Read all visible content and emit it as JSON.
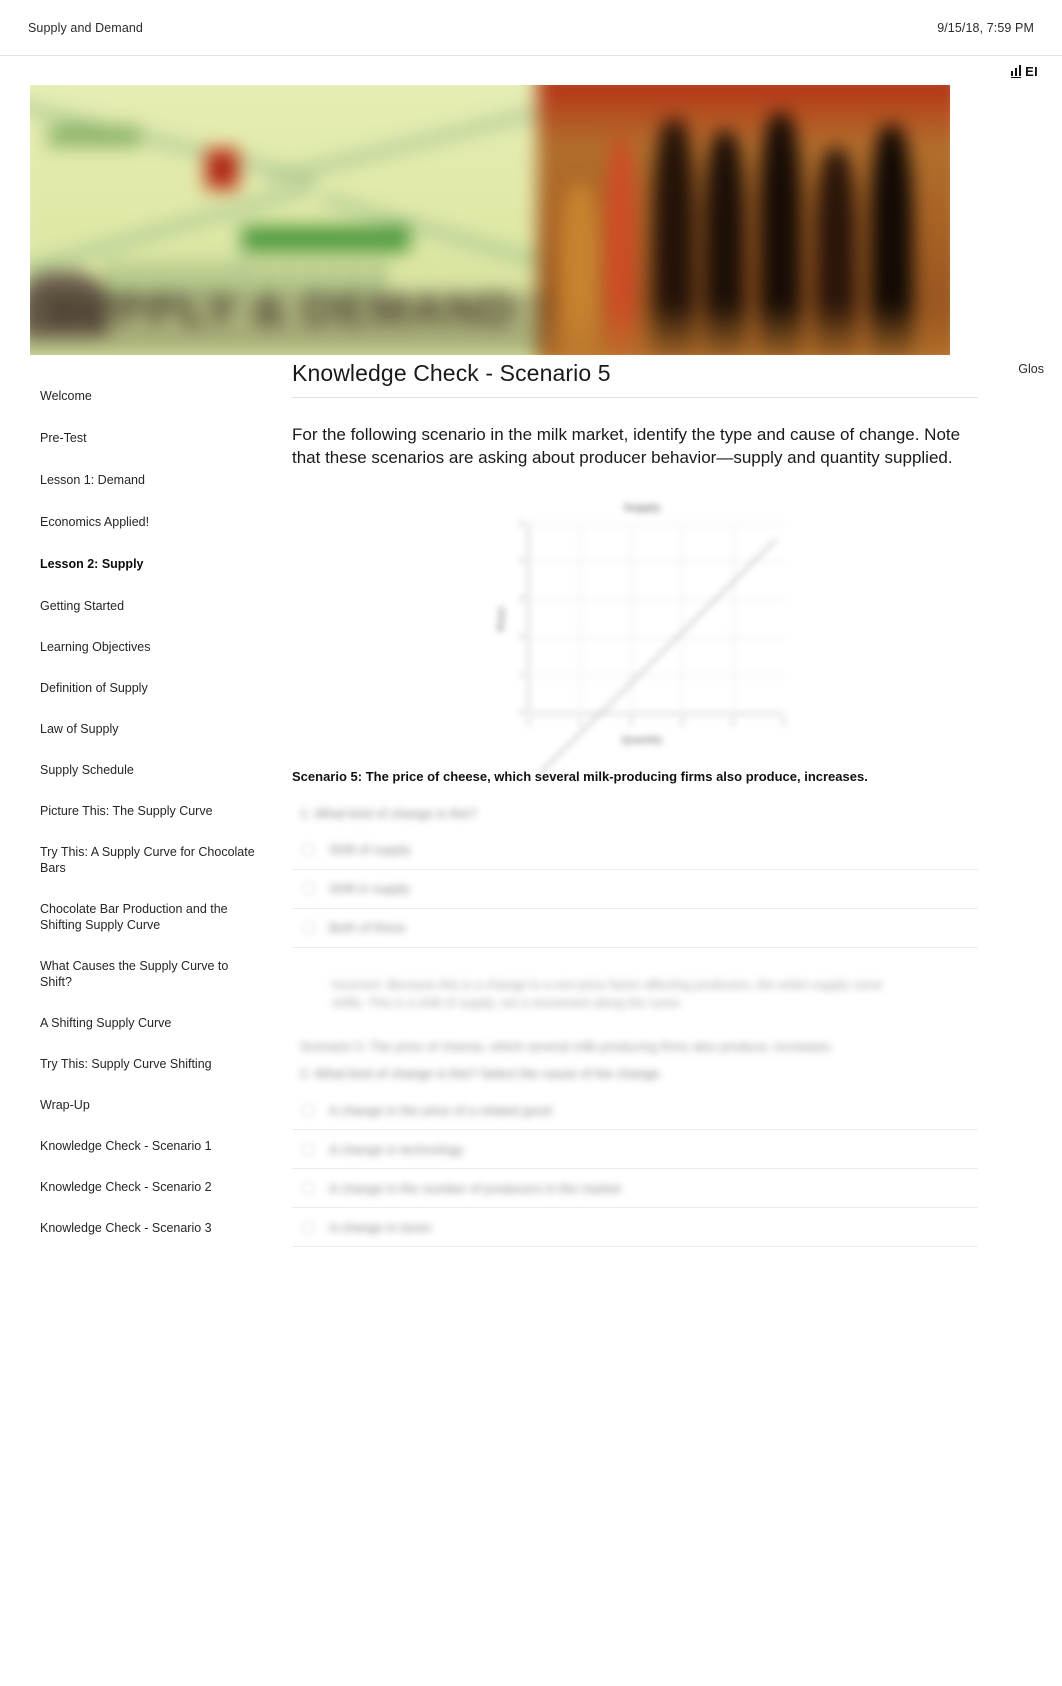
{
  "print_header": {
    "document_title": "Supply and Demand",
    "timestamp": "9/15/18, 7:59 PM"
  },
  "brand": {
    "icon": "bar-chart-icon",
    "label": "EI"
  },
  "banner": {
    "title_text": "SUPPLY & DEMAND",
    "alt": "Supply and Demand course banner"
  },
  "glossary": {
    "label": "Glos"
  },
  "sidebar": {
    "items": [
      {
        "label": "Welcome",
        "section": false
      },
      {
        "label": "Pre-Test",
        "section": false
      },
      {
        "label": "Lesson 1: Demand",
        "section": false
      },
      {
        "label": "Economics Applied!",
        "section": false
      },
      {
        "label": "Lesson 2: Supply",
        "section": true
      },
      {
        "label": "Getting Started",
        "section": false
      },
      {
        "label": "Learning Objectives",
        "section": false
      },
      {
        "label": "Definition of Supply",
        "section": false
      },
      {
        "label": "Law of Supply",
        "section": false
      },
      {
        "label": "Supply Schedule",
        "section": false
      },
      {
        "label": "Picture This: The Supply Curve",
        "section": false
      },
      {
        "label": "Try This: A Supply Curve for Chocolate Bars",
        "section": false
      },
      {
        "label": "Chocolate Bar Production and the Shifting Supply Curve",
        "section": false
      },
      {
        "label": "What Causes the Supply Curve to Shift?",
        "section": false
      },
      {
        "label": "A Shifting Supply Curve",
        "section": false
      },
      {
        "label": "Try This: Supply Curve Shifting",
        "section": false
      },
      {
        "label": "Wrap-Up",
        "section": false
      },
      {
        "label": "Knowledge Check - Scenario 1",
        "section": false
      },
      {
        "label": "Knowledge Check - Scenario 2",
        "section": false
      },
      {
        "label": "Knowledge Check - Scenario 3",
        "section": false
      }
    ]
  },
  "main": {
    "page_title": "Knowledge Check - Scenario 5",
    "intro": "For the following scenario in the milk market, identify the type and cause of change. Note that these scenarios are asking about producer behavior—supply and quantity supplied.",
    "scenario": "Scenario 5: The price of cheese, which several milk-producing firms also produce, increases.",
    "question_1": {
      "prompt": "1. What kind of change is this?",
      "options": [
        "Shift of supply",
        "Shift in supply",
        "Both of these"
      ]
    },
    "feedback": "Incorrect. Because this is a change in a non-price factor affecting producers, the entire supply curve shifts. This is a shift of supply, not a movement along the curve.",
    "question_2": {
      "heading": "Scenario 5: The price of cheese, which several milk-producing firms also produce, increases.",
      "prompt": "2. What kind of change is this? Select the cause of the change.",
      "options": [
        "A change in the price of a related good",
        "A change in technology",
        "A change in the number of producers in the market",
        "A change in taxes"
      ]
    }
  },
  "chart_data": {
    "type": "line",
    "title": "Supply",
    "xlabel": "Quantity",
    "ylabel": "Price",
    "series": [
      {
        "name": "Supply",
        "x": [
          0,
          1,
          2,
          3,
          4,
          5
        ],
        "values": [
          0,
          1,
          2,
          3,
          4,
          5
        ]
      }
    ],
    "x_ticks": [
      "0",
      "1",
      "2",
      "3",
      "4",
      "5"
    ],
    "y_ticks": [
      "0",
      "1",
      "2",
      "3",
      "4",
      "5"
    ],
    "xlim": [
      0,
      5
    ],
    "ylim": [
      0,
      5
    ],
    "grid": true,
    "legend_position": "none",
    "note": "Upward-sloping supply curve (blurred in source image)"
  }
}
